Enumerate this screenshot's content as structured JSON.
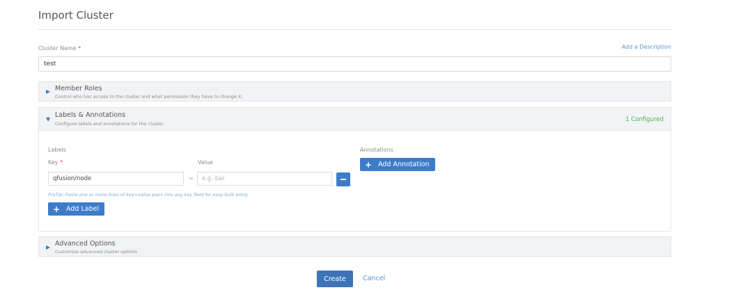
{
  "page": {
    "title": "Import Cluster"
  },
  "cluster_name": {
    "label": "Cluster Name",
    "required_marker": "*",
    "value": "test",
    "add_description": "Add a Description"
  },
  "sections": {
    "member_roles": {
      "title": "Member Roles",
      "description": "Control who has access to the cluster and what permission they have to change it.",
      "expanded": false
    },
    "labels_annotations": {
      "title": "Labels & Annotations",
      "description": "Configure labels and annotations for the cluster.",
      "status": "1 Configured",
      "expanded": true,
      "labels": {
        "heading": "Labels",
        "key_label": "Key",
        "key_required_marker": "*",
        "value_label": "Value",
        "rows": [
          {
            "key": "qfusion/node",
            "separator": "=",
            "value": "",
            "value_placeholder": "e.g. bar"
          }
        ],
        "protip": "ProTip: Paste one or more lines of key=value pairs into any key field for easy bulk entry.",
        "add_button": "Add Label"
      },
      "annotations": {
        "heading": "Annotations",
        "add_button": "Add Annotation"
      }
    },
    "advanced_options": {
      "title": "Advanced Options",
      "description": "Customize advanced cluster options",
      "expanded": false
    }
  },
  "footer": {
    "create": "Create",
    "cancel": "Cancel"
  },
  "icons": {
    "collapsed": "caret-right-icon",
    "expanded": "caret-down-icon",
    "add": "plus-icon",
    "remove": "minus-icon"
  },
  "colors": {
    "accent": "#3d7cc9",
    "required": "#e04848",
    "status_ok": "#4caf50",
    "link": "#5b93d3"
  }
}
